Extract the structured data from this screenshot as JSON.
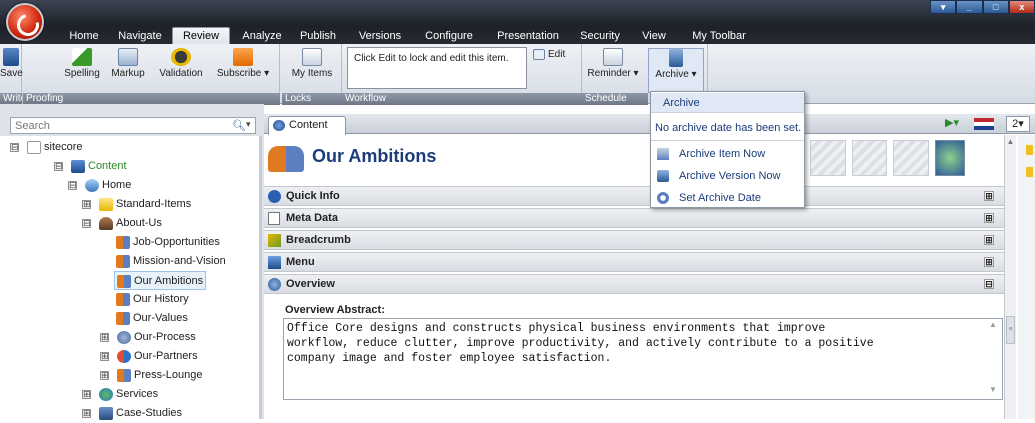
{
  "window": {
    "min": "_",
    "max": "□",
    "close": "x",
    "restore": "▾"
  },
  "tabs": [
    "Home",
    "Navigate",
    "Review",
    "Analyze",
    "Publish",
    "Versions",
    "Configure",
    "Presentation",
    "Security",
    "View",
    "My Toolbar"
  ],
  "active_tab": "Review",
  "ribbon": {
    "write": {
      "group": "Write",
      "save": "Save"
    },
    "proofing": {
      "group": "Proofing",
      "spelling": "Spelling",
      "markup": "Markup",
      "validation": "Validation",
      "subscribe": "Subscribe"
    },
    "locks": {
      "group": "Locks",
      "my_items": "My Items"
    },
    "workflow": {
      "group": "Workflow",
      "message": "Click Edit to lock and edit this item.",
      "edit": "Edit"
    },
    "schedule": {
      "group": "Schedule",
      "reminder": "Reminder",
      "archive": "Archive"
    }
  },
  "search": {
    "placeholder": "Search"
  },
  "tree": [
    {
      "label": "sitecore",
      "exp": "⊟"
    },
    {
      "label": "Content",
      "exp": "⊟"
    },
    {
      "label": "Home",
      "exp": "⊟"
    },
    {
      "label": "Standard-Items",
      "exp": "⊞"
    },
    {
      "label": "About-Us",
      "exp": "⊟"
    },
    {
      "label": "Job-Opportunities"
    },
    {
      "label": "Mission-and-Vision"
    },
    {
      "label": "Our Ambitions"
    },
    {
      "label": "Our History"
    },
    {
      "label": "Our-Values"
    },
    {
      "label": "Our-Process",
      "exp": "⊞"
    },
    {
      "label": "Our-Partners",
      "exp": "⊞"
    },
    {
      "label": "Press-Lounge",
      "exp": "⊞"
    },
    {
      "label": "Services",
      "exp": "⊞"
    },
    {
      "label": "Case-Studies",
      "exp": "⊞"
    }
  ],
  "content": {
    "tab": "Content",
    "title": "Our Ambitions",
    "sections": [
      "Quick Info",
      "Meta Data",
      "Breadcrumb",
      "Menu",
      "Overview"
    ],
    "expand": "⊞",
    "collapse": "⊟",
    "overview_label": "Overview Abstract:",
    "overview_text": "Office Core designs and constructs physical business environments that improve\nworkflow, reduce clutter, improve productivity, and actively contribute to a positive\ncompany image and foster employee satisfaction."
  },
  "dropdown": {
    "header": "Archive",
    "info": "No archive date has been set.",
    "items": [
      "Archive Item Now",
      "Archive Version Now",
      "Set Archive Date"
    ]
  },
  "toolbar_right": {
    "lang": "2"
  }
}
